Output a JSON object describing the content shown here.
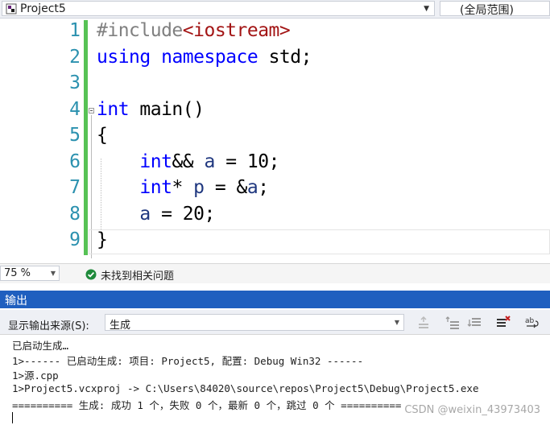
{
  "navbar": {
    "project_name": "Project5",
    "scope": "(全局范围)"
  },
  "editor": {
    "line_numbers": [
      "1",
      "2",
      "3",
      "4",
      "5",
      "6",
      "7",
      "8",
      "9"
    ],
    "lines": [
      [
        {
          "t": "#include",
          "c": "inc"
        },
        {
          "t": "<iostream>",
          "c": "str"
        }
      ],
      [
        {
          "t": "using",
          "c": "kw"
        },
        {
          "t": " "
        },
        {
          "t": "namespace",
          "c": "kw"
        },
        {
          "t": " std;"
        }
      ],
      [],
      [
        {
          "t": "int",
          "c": "kw"
        },
        {
          "t": " main()"
        }
      ],
      [
        {
          "t": "{"
        }
      ],
      [
        {
          "t": "    "
        },
        {
          "t": "int",
          "c": "kw"
        },
        {
          "t": "&& "
        },
        {
          "t": "a",
          "c": "var"
        },
        {
          "t": " = 10;"
        }
      ],
      [
        {
          "t": "    "
        },
        {
          "t": "int",
          "c": "kw"
        },
        {
          "t": "* "
        },
        {
          "t": "p",
          "c": "var"
        },
        {
          "t": " = &"
        },
        {
          "t": "a",
          "c": "var"
        },
        {
          "t": ";"
        }
      ],
      [
        {
          "t": "    "
        },
        {
          "t": "a",
          "c": "var"
        },
        {
          "t": " = 20;"
        }
      ],
      [
        {
          "t": "}"
        }
      ]
    ]
  },
  "status": {
    "zoom": "75 %",
    "issues": "未找到相关问题"
  },
  "output": {
    "title": "输出",
    "source_label": "显示输出来源(S):",
    "source_value": "生成",
    "lines": [
      "已启动生成…",
      "1>------ 已启动生成: 项目: Project5, 配置: Debug Win32 ------",
      "1>源.cpp",
      "1>Project5.vcxproj -> C:\\Users\\84020\\source\\repos\\Project5\\Debug\\Project5.exe",
      "========== 生成: 成功 1 个，失败 0 个，最新 0 个，跳过 0 个 =========="
    ],
    "watermark": "CSDN @weixin_43973403"
  },
  "colors": {
    "keyword": "#0000ff",
    "include": "#808080",
    "string": "#a31515",
    "line_number": "#2b91af",
    "change_bar": "#57c255",
    "output_title_bg": "#1f5fbf"
  }
}
